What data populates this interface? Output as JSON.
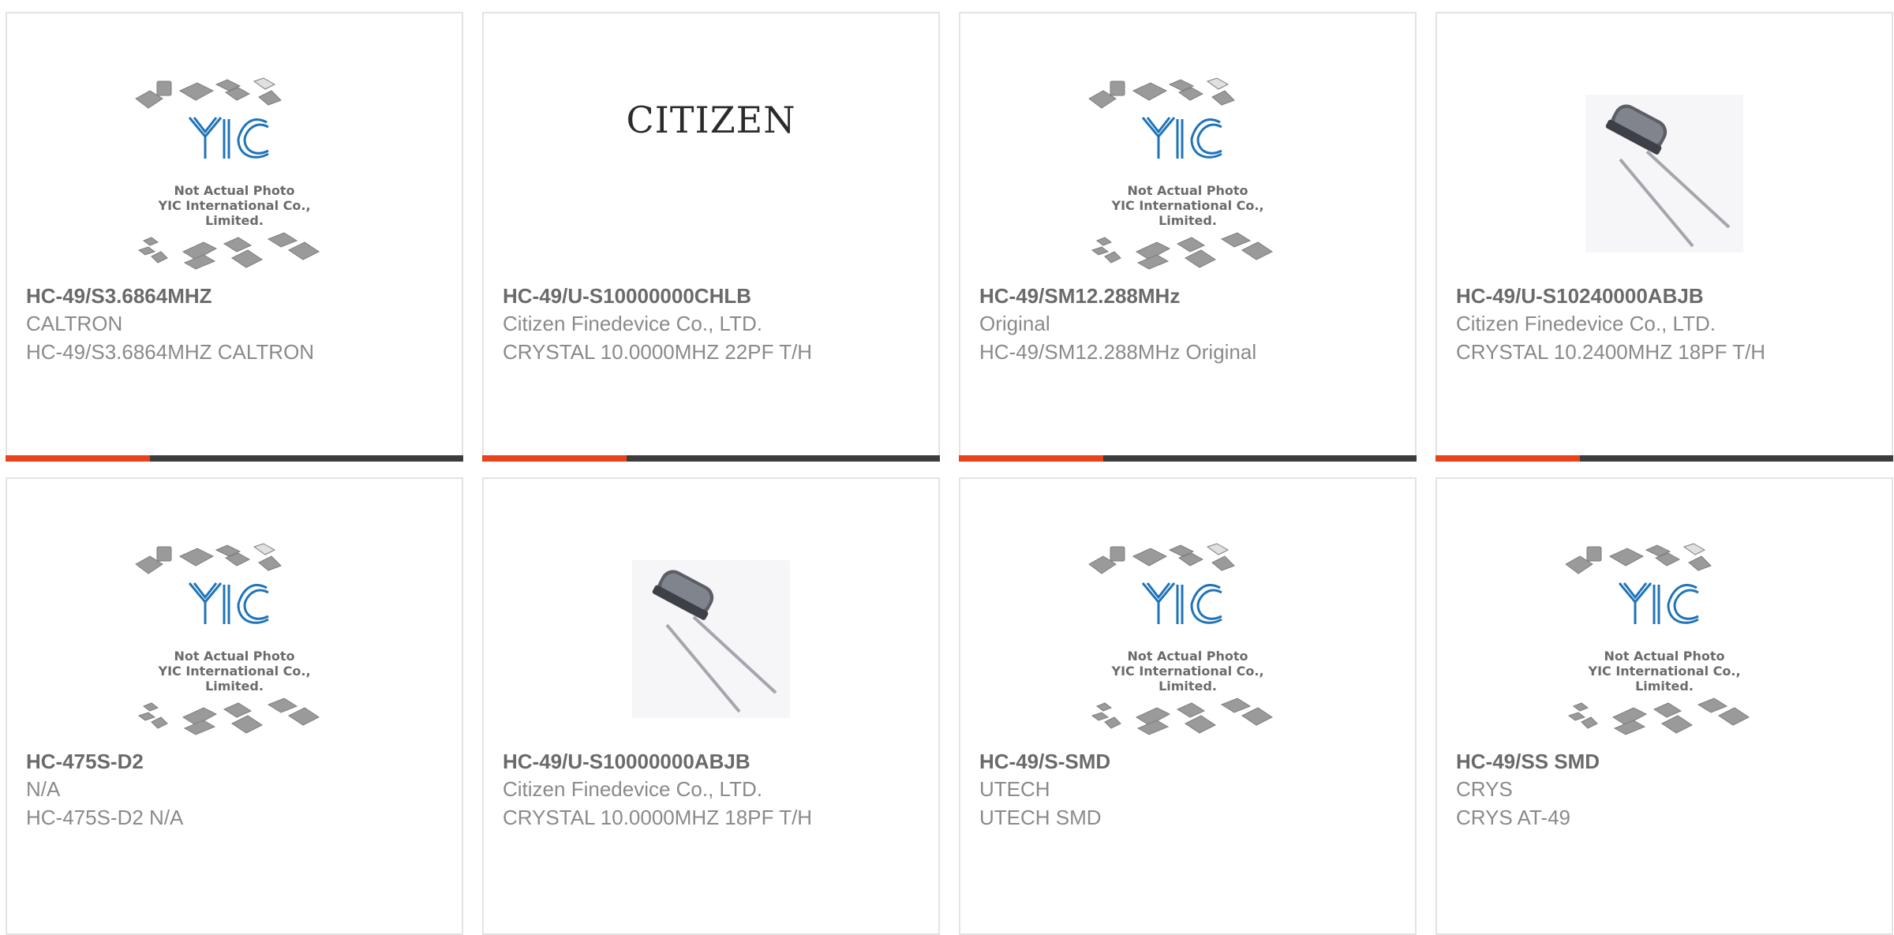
{
  "colors": {
    "accent": "#e8431a",
    "bar_dark": "#3d3d3d",
    "card_border": "#e3e3e3",
    "title_text": "#6a6a6a",
    "body_text": "#8a8a8a",
    "logo_blue": "#1f74b8"
  },
  "placeholder": {
    "line1": "Not Actual Photo",
    "line2": "YIC International Co., Limited."
  },
  "products": [
    {
      "part_number": "HC-49/S3.6864MHZ",
      "manufacturer": "CALTRON",
      "description": "HC-49/S3.6864MHZ CALTRON",
      "image": "placeholder"
    },
    {
      "part_number": "HC-49/U-S10000000CHLB",
      "manufacturer": "Citizen Finedevice Co., LTD.",
      "description": "CRYSTAL 10.0000MHZ 22PF T/H",
      "image": "brand-logo",
      "logo_text": "CITIZEN"
    },
    {
      "part_number": "HC-49/SM12.288MHz",
      "manufacturer": "Original",
      "description": "HC-49/SM12.288MHz Original",
      "image": "placeholder"
    },
    {
      "part_number": "HC-49/U-S10240000ABJB",
      "manufacturer": "Citizen Finedevice Co., LTD.",
      "description": "CRYSTAL 10.2400MHZ 18PF T/H",
      "image": "crystal-photo"
    },
    {
      "part_number": "HC-475S-D2",
      "manufacturer": "N/A",
      "description": "HC-475S-D2 N/A",
      "image": "placeholder"
    },
    {
      "part_number": "HC-49/U-S10000000ABJB",
      "manufacturer": "Citizen Finedevice Co., LTD.",
      "description": "CRYSTAL 10.0000MHZ 18PF T/H",
      "image": "crystal-photo"
    },
    {
      "part_number": "HC-49/S-SMD",
      "manufacturer": "UTECH",
      "description": "UTECH SMD",
      "image": "placeholder"
    },
    {
      "part_number": "HC-49/SS SMD",
      "manufacturer": "CRYS",
      "description": "CRYS AT-49",
      "image": "placeholder"
    }
  ]
}
